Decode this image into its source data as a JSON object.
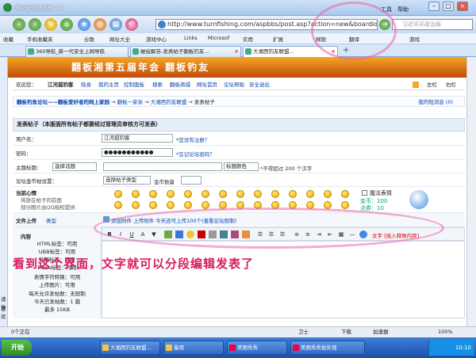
{
  "browser": {
    "title": "360安全浏览器 7.1",
    "menu": [
      "工具",
      "帮助"
    ],
    "address": "http://www.turnfishing.com/aspbbs/post.asp?action=new&boardid=...",
    "search_placeholder": "习近平开政治局",
    "favorites": [
      "收藏",
      "手机收藏夹",
      "谷歌",
      "网址大全",
      "游戏中心",
      "Links",
      "Microsof",
      "实用",
      "扩展",
      "网银",
      "翻译",
      "游戏"
    ],
    "tabs": [
      {
        "label": "360导航_新一代安全上网导航",
        "active": false
      },
      {
        "label": "破绽解答-发表帖子翻板钓友...",
        "active": false
      },
      {
        "label": "大湘西钓友联盟...",
        "active": true
      }
    ],
    "left_strip": [
      "请你",
      "喜欢"
    ]
  },
  "page": {
    "banner_text": "翻板湘第五届年会   翻板钓友",
    "welcome": "欢迎您：",
    "username": "江河孤钓客",
    "user_links": [
      "隐身",
      "我的主页",
      "控制面板",
      "搜索",
      "翻板商城",
      "网址首页",
      "论坛帮助",
      "安全退出"
    ],
    "view_links": [
      "左栏",
      "右栏"
    ],
    "breadcrumb": [
      "翻板钓鱼论坛——翻板爱好者的网上家园",
      "翻板一家亲",
      "大湘西钓友联盟",
      "发表帖子"
    ],
    "my_posts": "我的短消息 (0)",
    "form_title": "发表帖子（本版面所有帖子都要经过管理员审核方可发表）",
    "user_label": "用户名：",
    "user_value": "江河孤钓客",
    "user_hint": "*您没有注册？",
    "pass_label": "密码：",
    "pass_value": "●●●●●●●●●●●",
    "pass_hint": "*忘记论坛密码？",
    "subject_label": "主题标题：",
    "subject_select": "选择话题",
    "subject_value": "",
    "subject_style": "标题颜色",
    "subject_rule": "*不得超过 200 个汉字",
    "coin_label": "论坛金币帖设置：",
    "coin_select": "选择帖子类型",
    "coin_text": "金币数量",
    "mood_label": "当前心情",
    "mood_desc1": "将放在帖子的前面",
    "mood_desc2": "部分图片由QQ授权提供",
    "magic_label": "魔法表情",
    "gold": "金币：100",
    "points": "点券：10",
    "upload_label": "文件上传",
    "upload_type": "类型",
    "upload_bar": "添加附件  上传附件  今天还可上传100个(查看论坛限制)",
    "content_label": "内容",
    "left_info": [
      "HTML标签：可用",
      "UBB标签：可用",
      "贴图标签：可用",
      "Flash标签：可用",
      "表情字符转换：可用",
      "上传图片：可用",
      "每天允许发帖数：无限制",
      "今天已发帖数：1 篇",
      "最多 15KB"
    ],
    "format_tail": "文字 [插入特殊内容]"
  },
  "annotation": "看到这个界面，文字就可以分段编辑发表了",
  "status": {
    "left": "0个正在",
    "zoom": "100%",
    "protect": "卫士",
    "download": "加速器",
    "misc": "下载"
  },
  "taskbar": {
    "start": "开始",
    "tasks": [
      "大湘西钓友联盟...",
      "备用",
      "美图秀秀",
      "美图秀秀批处理"
    ],
    "clock": "10:10"
  },
  "colors": {
    "accent": "#3d7fd8",
    "link": "#0645ad",
    "annotation": "#d81b60",
    "banner": "#e07a1b"
  }
}
